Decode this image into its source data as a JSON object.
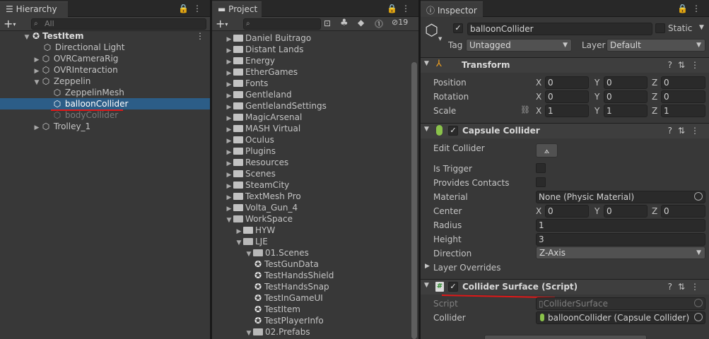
{
  "hierarchy": {
    "tab": "Hierarchy",
    "search_placeholder": "All",
    "items": [
      {
        "label": "TestItem"
      },
      {
        "label": "Directional Light"
      },
      {
        "label": "OVRCameraRig"
      },
      {
        "label": "OVRInteraction"
      },
      {
        "label": "Zeppelin"
      },
      {
        "label": "ZeppelinMesh"
      },
      {
        "label": "balloonCollider"
      },
      {
        "label": "bodyCollider"
      },
      {
        "label": "Trolley_1"
      }
    ]
  },
  "project": {
    "tab": "Project",
    "hidden_count": "19",
    "items": [
      {
        "label": "Daniel Buitrago"
      },
      {
        "label": "Distant Lands"
      },
      {
        "label": "Energy"
      },
      {
        "label": "EtherGames"
      },
      {
        "label": "Fonts"
      },
      {
        "label": "Gentleland"
      },
      {
        "label": "GentlelandSettings"
      },
      {
        "label": "MagicArsenal"
      },
      {
        "label": "MASH Virtual"
      },
      {
        "label": "Oculus"
      },
      {
        "label": "Plugins"
      },
      {
        "label": "Resources"
      },
      {
        "label": "Scenes"
      },
      {
        "label": "SteamCity"
      },
      {
        "label": "TextMesh Pro"
      },
      {
        "label": "Volta_Gun_4"
      },
      {
        "label": "WorkSpace"
      },
      {
        "label": "HYW"
      },
      {
        "label": "LJE"
      },
      {
        "label": "01.Scenes"
      },
      {
        "label": "TestGunData"
      },
      {
        "label": "TestHandsShield"
      },
      {
        "label": "TestHandsSnap"
      },
      {
        "label": "TestInGameUI"
      },
      {
        "label": "TestItem"
      },
      {
        "label": "TestPlayerInfo"
      },
      {
        "label": "02.Prefabs"
      }
    ]
  },
  "inspector": {
    "tab": "Inspector",
    "object_name": "balloonCollider",
    "static_label": "Static",
    "tag_label": "Tag",
    "tag_value": "Untagged",
    "layer_label": "Layer",
    "layer_value": "Default",
    "transform": {
      "title": "Transform",
      "position_label": "Position",
      "rotation_label": "Rotation",
      "scale_label": "Scale",
      "position": {
        "x": "0",
        "y": "0",
        "z": "0"
      },
      "rotation": {
        "x": "0",
        "y": "0",
        "z": "0"
      },
      "scale": {
        "x": "1",
        "y": "1",
        "z": "1"
      }
    },
    "capsule": {
      "title": "Capsule Collider",
      "edit_collider_label": "Edit Collider",
      "is_trigger_label": "Is Trigger",
      "provides_contacts_label": "Provides Contacts",
      "material_label": "Material",
      "material_value": "None (Physic Material)",
      "center_label": "Center",
      "center": {
        "x": "0",
        "y": "0",
        "z": "0"
      },
      "radius_label": "Radius",
      "radius_value": "1",
      "height_label": "Height",
      "height_value": "3",
      "direction_label": "Direction",
      "direction_value": "Z-Axis",
      "layer_overrides_label": "Layer Overrides"
    },
    "surface": {
      "title": "Collider Surface (Script)",
      "script_label": "Script",
      "script_value": "ColliderSurface",
      "collider_label": "Collider",
      "collider_value": "balloonCollider (Capsule Collider)"
    },
    "axis": {
      "x": "X",
      "y": "Y",
      "z": "Z"
    }
  },
  "colors": {
    "selection": "#2c5d87",
    "annotation": "#e01818",
    "panel": "#383838"
  }
}
